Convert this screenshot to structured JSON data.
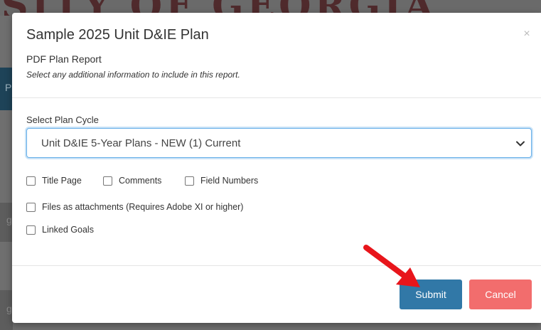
{
  "background": {
    "banner_text": "SITY OF GEORGIA",
    "strip_glyphs": [
      "P",
      "g",
      "g"
    ]
  },
  "modal": {
    "title": "Sample 2025 Unit D&IE Plan",
    "close_glyph": "×",
    "subtitle": "PDF Plan Report",
    "hint": "Select any additional information to include in this report.",
    "cycle_label": "Select Plan Cycle",
    "cycle_selected": "Unit D&IE 5-Year Plans - NEW (1) Current",
    "options_row1": [
      {
        "label": "Title Page",
        "checked": false
      },
      {
        "label": "Comments",
        "checked": false
      },
      {
        "label": "Field Numbers",
        "checked": false
      }
    ],
    "options_row2": [
      {
        "label": "Files as attachments (Requires Adobe XI or higher)",
        "checked": false
      }
    ],
    "options_row3": [
      {
        "label": "Linked Goals",
        "checked": false
      }
    ],
    "submit_label": "Submit",
    "cancel_label": "Cancel"
  },
  "colors": {
    "submit": "#3178a7",
    "cancel": "#f26d6d",
    "annotation_arrow": "#e8151b",
    "focus_ring": "#66afe9"
  }
}
